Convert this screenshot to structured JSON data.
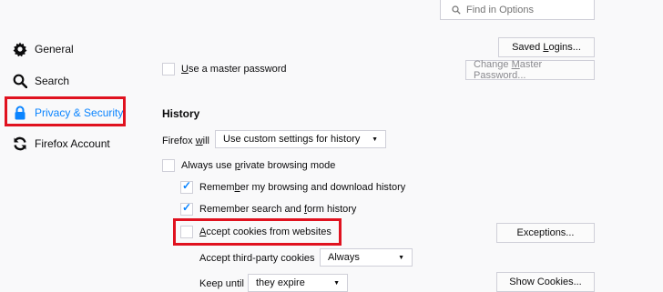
{
  "sidebar": {
    "items": [
      {
        "label": "General",
        "icon": "gear-icon"
      },
      {
        "label": "Search",
        "icon": "search-icon"
      },
      {
        "label": "Privacy & Security",
        "icon": "lock-icon",
        "selected": true
      },
      {
        "label": "Firefox Account",
        "icon": "sync-icon"
      }
    ]
  },
  "search": {
    "placeholder": "Find in Options",
    "value": ""
  },
  "logins": {
    "saved_logins_button": {
      "pre": "Saved ",
      "ul": "L",
      "post": "ogins..."
    },
    "master_password_label": {
      "pre": "",
      "ul": "U",
      "post": "se a master password"
    },
    "master_password_checked": false,
    "change_master_button": {
      "pre": "Change ",
      "ul": "M",
      "post": "aster Password..."
    }
  },
  "history": {
    "heading": "History",
    "firefox_will": {
      "pre": "Firefox ",
      "ul": "w",
      "post": "ill"
    },
    "mode_select": "Use custom settings for history",
    "always_private": {
      "pre": "Always use ",
      "ul": "p",
      "post": "rivate browsing mode"
    },
    "always_private_checked": false,
    "remember_browsing": {
      "pre": "Remem",
      "ul": "b",
      "post": "er my browsing and download history"
    },
    "remember_browsing_checked": true,
    "remember_search": {
      "pre": "Remember search and ",
      "ul": "f",
      "post": "orm history"
    },
    "remember_search_checked": true
  },
  "cookies": {
    "accept_label": {
      "pre": "",
      "ul": "A",
      "post": "ccept cookies from websites"
    },
    "accept_checked": false,
    "exceptions_button": "Exceptions...",
    "third_party_label": "Accept third-party cookies",
    "third_party_select": "Always",
    "keep_until_label": "Keep until",
    "keep_until_select": "they expire",
    "clear_cookies_button": "Show Cookies..."
  },
  "colors": {
    "accent": "#0a84ff",
    "highlight": "#e0121f"
  }
}
